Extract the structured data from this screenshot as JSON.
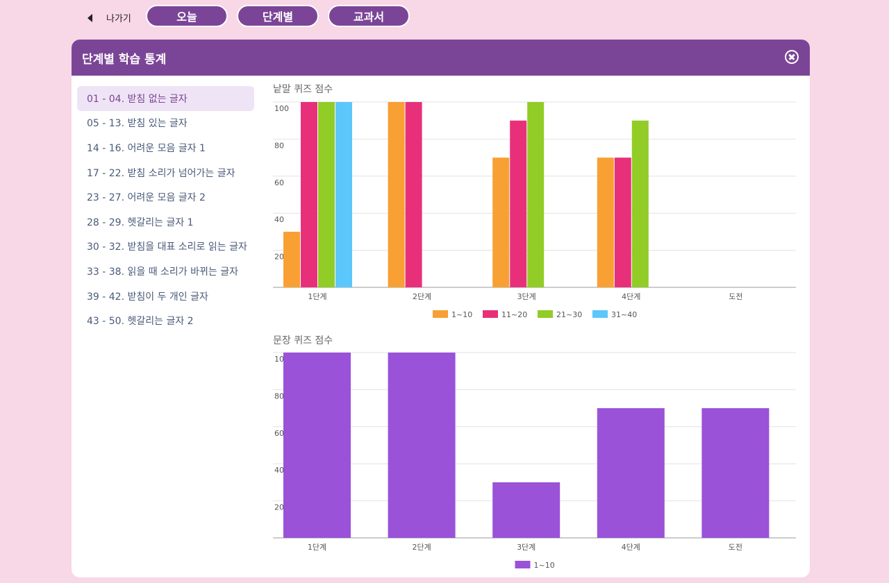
{
  "topbar": {
    "back_label": "나가기",
    "tabs": [
      "오늘",
      "단계별",
      "교과서"
    ]
  },
  "panel": {
    "title": "단계별 학습 통계"
  },
  "sidebar": {
    "items": [
      {
        "label": "01 - 04. 받침 없는 글자",
        "active": true
      },
      {
        "label": "05 - 13. 받침 있는 글자"
      },
      {
        "label": "14 - 16. 어려운 모음 글자 1"
      },
      {
        "label": "17 - 22. 받침 소리가 넘어가는 글자"
      },
      {
        "label": "23 - 27. 어려운 모음 글자 2"
      },
      {
        "label": "28 - 29. 헷갈리는 글자 1"
      },
      {
        "label": "30 - 32. 받침을 대표 소리로 읽는 글자"
      },
      {
        "label": "33 - 38. 읽을 때 소리가 바뀌는 글자"
      },
      {
        "label": "39 - 42. 받침이 두 개인 글자"
      },
      {
        "label": "43 - 50. 헷갈리는 글자 2"
      }
    ]
  },
  "colors": {
    "accent": "#7b4597",
    "series": [
      "#f8a033",
      "#e8307a",
      "#92cc26",
      "#5cc7fb"
    ],
    "sentence_bar": "#9a52d8"
  },
  "chart_data": [
    {
      "type": "bar",
      "title": "낱말 퀴즈 점수",
      "categories": [
        "1단계",
        "2단계",
        "3단계",
        "4단계",
        "도전"
      ],
      "series": [
        {
          "name": "1~10",
          "values": [
            30,
            100,
            70,
            70,
            null
          ]
        },
        {
          "name": "11~20",
          "values": [
            100,
            100,
            90,
            70,
            null
          ]
        },
        {
          "name": "21~30",
          "values": [
            100,
            null,
            100,
            90,
            null
          ]
        },
        {
          "name": "31~40",
          "values": [
            100,
            null,
            null,
            null,
            null
          ]
        }
      ],
      "ylim": [
        0,
        100
      ],
      "yticks": [
        20,
        40,
        60,
        80,
        100
      ],
      "grid": true,
      "legend": "bottom"
    },
    {
      "type": "bar",
      "title": "문장 퀴즈 점수",
      "categories": [
        "1단계",
        "2단계",
        "3단계",
        "4단계",
        "도전"
      ],
      "series": [
        {
          "name": "1~10",
          "values": [
            100,
            100,
            30,
            70,
            70
          ]
        }
      ],
      "ylim": [
        0,
        100
      ],
      "yticks": [
        20,
        40,
        60,
        80,
        100
      ],
      "grid": true,
      "legend": "bottom"
    }
  ]
}
